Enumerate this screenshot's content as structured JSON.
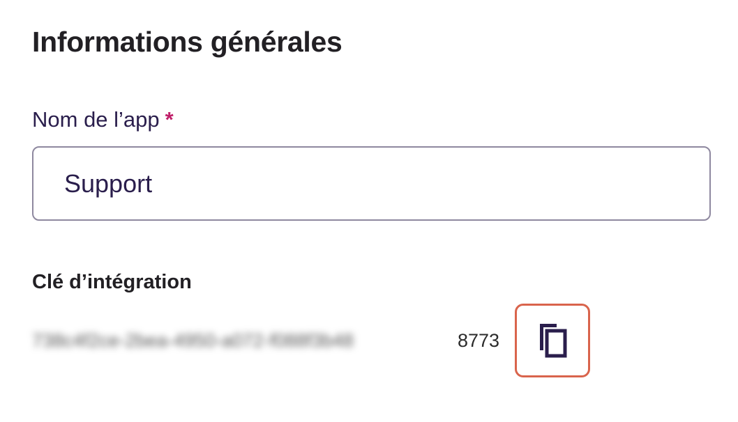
{
  "section": {
    "title": "Informations générales"
  },
  "app_name_field": {
    "label": "Nom de l’app",
    "required_marker": "*",
    "value": "Support"
  },
  "integration_key": {
    "label": "Clé d’intégration",
    "blurred_part": "738c4f2ce-2bea-4950-a072-f088f3b48",
    "visible_suffix": "8773",
    "copy_icon": "copy-icon"
  },
  "colors": {
    "required": "#c0206a",
    "label_purple": "#2a1e4c",
    "highlight": "#d9644c"
  }
}
